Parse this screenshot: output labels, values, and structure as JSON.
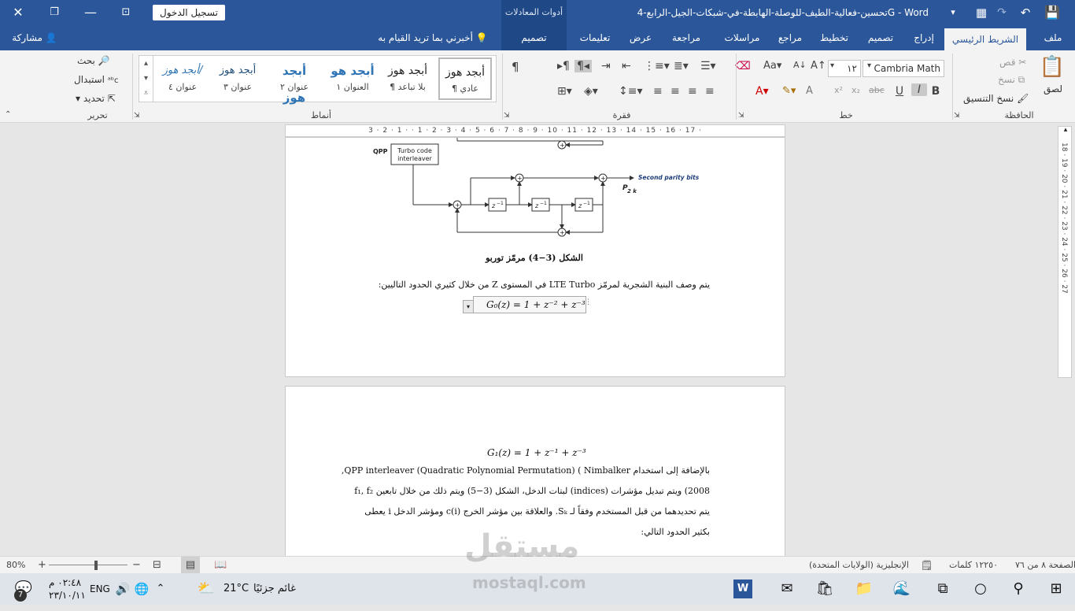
{
  "titlebar": {
    "doc_title": "تحسين-فعالية-الطيف-للوصلة-الهابطة-في-شبكات-الجيل-الرابع-4G",
    "app_name": "Word",
    "app_sep": "-",
    "sign_in": "تسجيل الدخول",
    "contextual": "أدوات المعادلات"
  },
  "tabs": [
    "ملف",
    "الشريط الرئيسي",
    "إدراج",
    "تصميم",
    "تخطيط",
    "مراجع",
    "مراسلات",
    "مراجعة",
    "عرض",
    "تعليمات",
    "تصميم"
  ],
  "tell_me": "أخبرني بما تريد القيام به",
  "share": "مشاركة",
  "ribbon": {
    "clipboard": {
      "label": "الحافظة",
      "paste": "لصق",
      "cut": "قص",
      "copy": "نسخ",
      "format_painter": "نسخ التنسيق"
    },
    "font": {
      "label": "خط",
      "font_name": "Cambria Math",
      "font_size": "١٢",
      "bold": "B",
      "italic": "I",
      "underline": "U"
    },
    "paragraph": {
      "label": "فقرة"
    },
    "styles": {
      "label": "أنماط",
      "items": [
        {
          "preview": "أبجد هوز",
          "name": "¶ عادي"
        },
        {
          "preview": "أبجد هوز",
          "name": "¶ بلا تباعد"
        },
        {
          "preview": "أبجد هو",
          "name": "العنوان ١"
        },
        {
          "preview": "أبجد هوز",
          "name": "عنوان ٢"
        },
        {
          "preview": "أبجد هوز",
          "name": "عنوان ٣"
        },
        {
          "preview": "أبجد هوز/",
          "name": "عنوان ٤"
        }
      ]
    },
    "editing": {
      "label": "تحرير",
      "find": "بحث",
      "replace": "استبدال",
      "select": "تحديد"
    }
  },
  "ruler_text": "3 · 2 · 1 · · 1 · 2 · 3 · 4 · 5 · 6 · 7 · 8 · 9 · 10 · 11 · 12 · 13 · 14 · 15 · 16 · 17 ·",
  "vruler_text": "18 · 19 · 20 · 21 · 22 · 23 · 24 · 25 · 26 · 27",
  "page1": {
    "diagram": {
      "qpp": "QPP",
      "interleaver_l1": "Turbo code",
      "interleaver_l2": "interleaver",
      "second_parity": "Second parity bits",
      "p2k": "P",
      "p2k_sub": "2 k",
      "delay": "z",
      "delay_sup": "−1",
      "plus": "+"
    },
    "caption": "الشكل (3−4) مرمّز توربو",
    "para": "يتم وصف البنية الشجرية لمرمّز LTE Turbo في المستوى Z من خلال كثيري الحدود التاليين:",
    "eq0": "G₀(z) = 1 + z⁻² + z⁻³"
  },
  "page2": {
    "eq1": "G₁(z) = 1 + z⁻¹ + z⁻³",
    "line1": "بالإضافة إلى استخدام QPP interleaver (Quadratic Polynomial Permutation) ( Nimbalker,",
    "line2": "2008) ويتم تبديل مؤشرات (indices) لبتات الدخل، الشكل (3−5) ويتم ذلك من خلال تابعين  f₁, f₂",
    "line3": "يتم تحديدهما من قبل المستخدم وفقاً لـ Sₖ. والعلاقة بين مؤشر الخرج (i)c ومؤشر الدخل i يعطى",
    "line4": "بكثير الحدود التالي:"
  },
  "status": {
    "page": "الصفحة ٨ من ٧٦",
    "words": "١٢٢٥٠ كلمات",
    "language": "الإنجليزية (الولايات المتحدة)",
    "zoom": "80%"
  },
  "taskbar": {
    "weather_text": "غائم جزئيًا",
    "temp": "21°C",
    "lang": "ENG",
    "time": "٠٢:٤٨ م",
    "date": "٢٣/١٠/١١",
    "notif_count": "7"
  },
  "watermark": {
    "ar": "مستقل",
    "en": "mostaql.com"
  }
}
